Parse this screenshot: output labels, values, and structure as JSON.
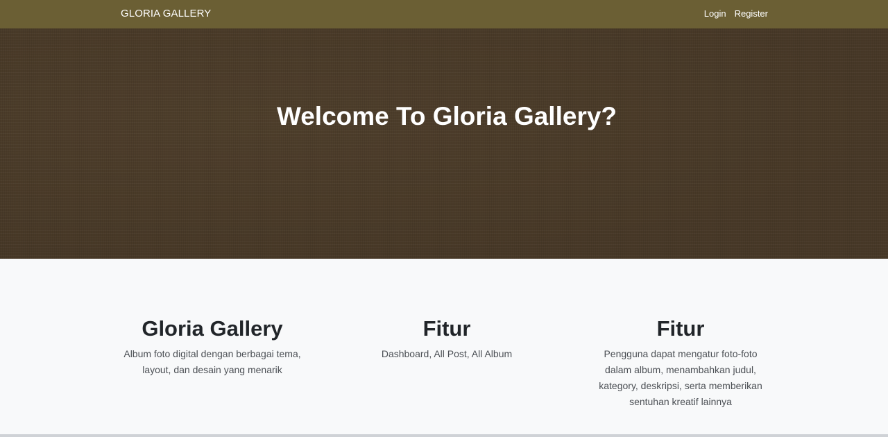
{
  "navbar": {
    "brand": "GLORIA GALLERY",
    "links": [
      "Login",
      "Register"
    ]
  },
  "hero": {
    "title": "Welcome To Gloria Gallery?"
  },
  "features": [
    {
      "title": "Gloria Gallery",
      "text": "Album foto digital dengan berbagai tema, layout, dan desain yang menarik"
    },
    {
      "title": "Fitur",
      "text": "Dashboard, All Post, All Album"
    },
    {
      "title": "Fitur",
      "text": "Pengguna dapat mengatur foto-foto dalam album, menambahkan judul, kategory, deskripsi, serta memberikan sentuhan kreatif lainnya"
    }
  ],
  "colors": {
    "navbar": "#6b5f34",
    "hero": "#4a3b29",
    "section": "#f8f9fa"
  }
}
